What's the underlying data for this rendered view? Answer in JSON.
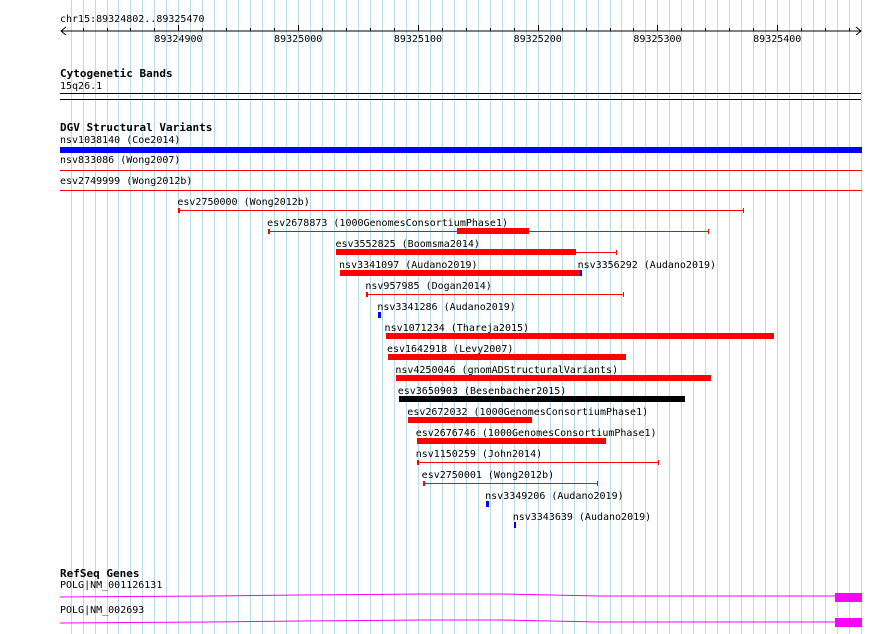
{
  "ruler": {
    "region_label": "chr15:89324802..89325470",
    "start": 89324802,
    "end": 89325470,
    "ticks": [
      "89324900",
      "89325000",
      "89325100",
      "89325200",
      "89325300",
      "89325400"
    ]
  },
  "cytoband": {
    "title": "Cytogenetic Bands",
    "label": "15q26.1"
  },
  "dgv": {
    "title": "DGV Structural Variants",
    "full_rows": [
      {
        "label": "nsv1038140 (Coe2014)",
        "color": "#0000ff",
        "style": "thick"
      },
      {
        "label": "nsv833086 (Wong2007)",
        "color": "#ff0000",
        "style": "thin"
      },
      {
        "label": "esv2749999 (Wong2012b)",
        "color": "#ff0000",
        "style": "thin"
      }
    ],
    "features": [
      {
        "label": "esv2750000 (Wong2012b)",
        "start": 89324900,
        "end": 89325372,
        "color": "#ff0000",
        "style": "thin"
      },
      {
        "label": "esv2678873 (1000GenomesConsortiumPhase1)",
        "start": 89324975,
        "end": 89325343,
        "color": "#ff0000",
        "style": "thin",
        "thick": [
          89325133,
          89325193
        ]
      },
      {
        "label": "esv3552825 (Boomsma2014)",
        "start": 89325032,
        "end": 89325266,
        "color": "#ff0000",
        "style": "thin",
        "thick": [
          89325032,
          89325232
        ]
      },
      {
        "label": "nsv3341097 (Audano2019)",
        "start": 89325035,
        "end": 89325235,
        "color": "#ff0000",
        "style": "thick"
      },
      {
        "label": "nsv3356292 (Audano2019)",
        "start": 89325235,
        "end": 89325237,
        "color": "#0000ff",
        "style": "thick",
        "label_at": "start"
      },
      {
        "label": "nsv957985 (Dogan2014)",
        "start": 89325057,
        "end": 89325272,
        "color": "#ff0000",
        "style": "thin"
      },
      {
        "label": "nsv3341286 (Audano2019)",
        "start": 89325067,
        "end": 89325069,
        "color": "#0000ff",
        "style": "thick"
      },
      {
        "label": "nsv1071234 (Thareja2015)",
        "start": 89325073,
        "end": 89325397,
        "color": "#ff0000",
        "style": "thick"
      },
      {
        "label": "esv1642918 (Levy2007)",
        "start": 89325075,
        "end": 89325274,
        "color": "#ff0000",
        "style": "thick"
      },
      {
        "label": "nsv4250046 (gnomADStructuralVariants)",
        "start": 89325082,
        "end": 89325345,
        "color": "#ff0000",
        "style": "thick"
      },
      {
        "label": "esv3650903 (Besenbacher2015)",
        "start": 89325084,
        "end": 89325323,
        "color": "#000000",
        "style": "thick"
      },
      {
        "label": "esv2672032 (1000GenomesConsortiumPhase1)",
        "start": 89325092,
        "end": 89325195,
        "color": "#ff0000",
        "style": "thick"
      },
      {
        "label": "esv2676746 (1000GenomesConsortiumPhase1)",
        "start": 89325099,
        "end": 89325257,
        "color": "#ff0000",
        "style": "thick"
      },
      {
        "label": "nsv1150259 (John2014)",
        "start": 89325099,
        "end": 89325301,
        "color": "#ff0000",
        "style": "thin"
      },
      {
        "label": "esv2750001 (Wong2012b)",
        "start": 89325104,
        "end": 89325250,
        "color": "#ff0000",
        "style": "thin"
      },
      {
        "label": "nsv3349206 (Audano2019)",
        "start": 89325157,
        "end": 89325159,
        "color": "#0000ff",
        "style": "thick"
      },
      {
        "label": "nsv3343639 (Audano2019)",
        "start": 89325180,
        "end": 89325182,
        "color": "#0000ff",
        "style": "thick"
      }
    ]
  },
  "refseq": {
    "title": "RefSeq Genes",
    "genes": [
      {
        "label": "POLG|NM_001126131",
        "color": "#ff00ff"
      },
      {
        "label": "POLG|NM_002693",
        "color": "#ff00ff"
      }
    ]
  }
}
